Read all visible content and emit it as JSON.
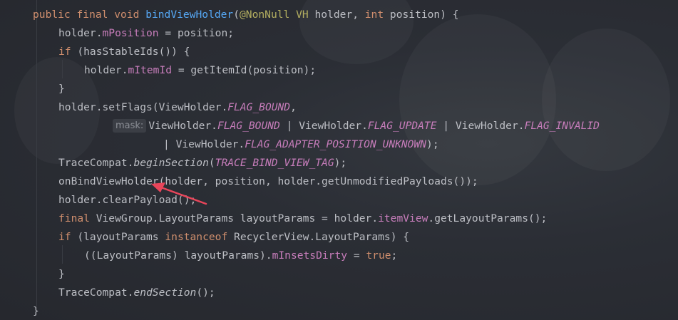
{
  "editor": {
    "colors": {
      "background": "#272a31",
      "text": "#bcbec4",
      "keyword": "#cf8e6d",
      "annotation": "#b3ae60",
      "method": "#56a8f5",
      "field": "#c77dbb",
      "arrow": "#e8455a"
    },
    "lines": {
      "l1": [
        "public",
        " ",
        "final",
        " ",
        "void",
        " ",
        "bindViewHolder",
        "(",
        "@NonNull",
        " ",
        "VH",
        " holder, ",
        "int",
        " position) {"
      ],
      "l2": [
        "holder.",
        "mPosition",
        " = position;"
      ],
      "l3": [
        "if",
        " (hasStableIds()) {"
      ],
      "l4": [
        "holder.",
        "mItemId",
        " = getItemId(position);"
      ],
      "l5": [
        "}"
      ],
      "l6": [
        "holder.setFlags(ViewHolder.",
        "FLAG_BOUND",
        ","
      ],
      "l7": [
        "mask:",
        "ViewHolder.",
        "FLAG_BOUND",
        " | ViewHolder.",
        "FLAG_UPDATE",
        " | ViewHolder.",
        "FLAG_INVALID"
      ],
      "l8": [
        "| ViewHolder.",
        "FLAG_ADAPTER_POSITION_UNKNOWN",
        ");"
      ],
      "l9": [
        "TraceCompat.",
        "beginSection",
        "(",
        "TRACE_BIND_VIEW_TAG",
        ");"
      ],
      "l10": [
        "onBindViewHolder(holder, position, holder.getUnmodifiedPayloads());"
      ],
      "l11": [
        "holder.clearPayload();"
      ],
      "l12": [
        "final",
        " ViewGroup.LayoutParams layoutParams = holder.",
        "itemView",
        ".getLayoutParams();"
      ],
      "l13": [
        "if",
        " (layoutParams ",
        "instanceof",
        " RecyclerView.LayoutParams) {"
      ],
      "l14": [
        "((LayoutParams) layoutParams).",
        "mInsetsDirty",
        " = ",
        "true",
        ";"
      ],
      "l15": [
        "}"
      ],
      "l16": [
        "TraceCompat.",
        "endSection",
        "();"
      ],
      "l17": [
        "}"
      ]
    }
  }
}
